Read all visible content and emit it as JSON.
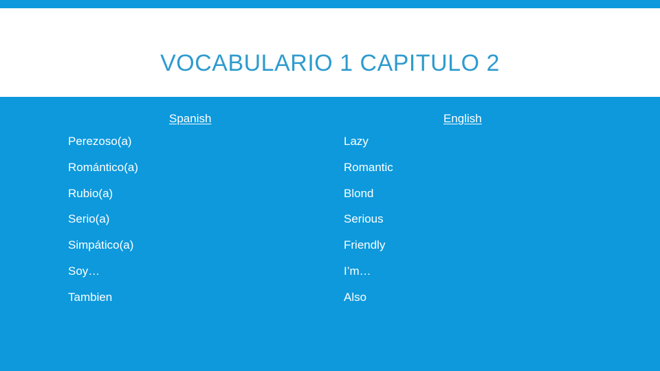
{
  "slide": {
    "title": "VOCABULARIO 1 CAPITULO 2",
    "accent_color": "#0d99dc",
    "title_color": "#2e9bce",
    "text_color": "#ffffff"
  },
  "table": {
    "headers": {
      "source": "Spanish",
      "target": "English"
    },
    "rows": [
      {
        "term": "Perezoso(a)",
        "translation": "Lazy"
      },
      {
        "term": "Romántico(a)",
        "translation": "Romantic"
      },
      {
        "term": "Rubio(a)",
        "translation": "Blond"
      },
      {
        "term": "Serio(a)",
        "translation": "Serious"
      },
      {
        "term": "Simpático(a)",
        "translation": "Friendly"
      },
      {
        "term": "Soy…",
        "translation": "I’m…"
      },
      {
        "term": "Tambien",
        "translation": "Also"
      }
    ]
  }
}
